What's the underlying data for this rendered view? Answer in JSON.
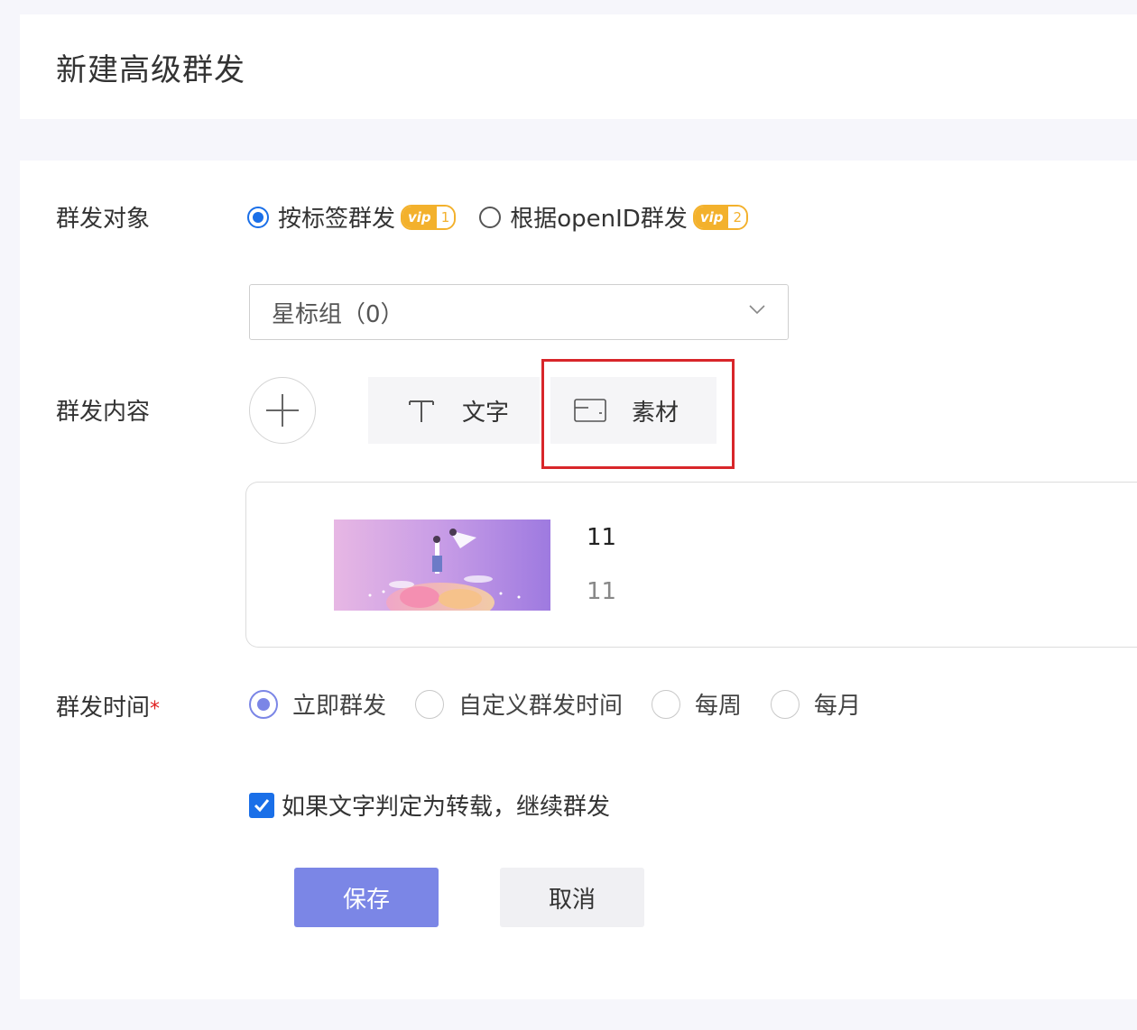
{
  "page": {
    "title": "新建高级群发"
  },
  "form": {
    "target": {
      "label": "群发对象",
      "options": [
        {
          "label": "按标签群发",
          "vip": "vip",
          "vip_level": "1",
          "checked": true
        },
        {
          "label": "根据openID群发",
          "vip": "vip",
          "vip_level": "2",
          "checked": false
        }
      ]
    },
    "tag_select": {
      "value": "星标组（0）"
    },
    "content": {
      "label": "群发内容",
      "types": [
        {
          "label": "文字",
          "icon": "text-type-icon"
        },
        {
          "label": "素材",
          "icon": "material-card-icon",
          "highlighted": true
        }
      ],
      "material": {
        "title": "11",
        "digest": "11"
      }
    },
    "time": {
      "label": "群发时间",
      "required_mark": "*",
      "options": [
        {
          "label": "立即群发",
          "checked": true
        },
        {
          "label": "自定义群发时间",
          "checked": false
        },
        {
          "label": "每周",
          "checked": false
        },
        {
          "label": "每月",
          "checked": false
        }
      ]
    },
    "reprint": {
      "label": "如果文字判定为转载，继续群发",
      "checked": true
    },
    "buttons": {
      "save": "保存",
      "cancel": "取消"
    }
  },
  "colors": {
    "accent": "#7b86e6",
    "radio_blue": "#1a6fe8",
    "vip": "#f3b12c",
    "highlight_red": "#d8262a"
  }
}
